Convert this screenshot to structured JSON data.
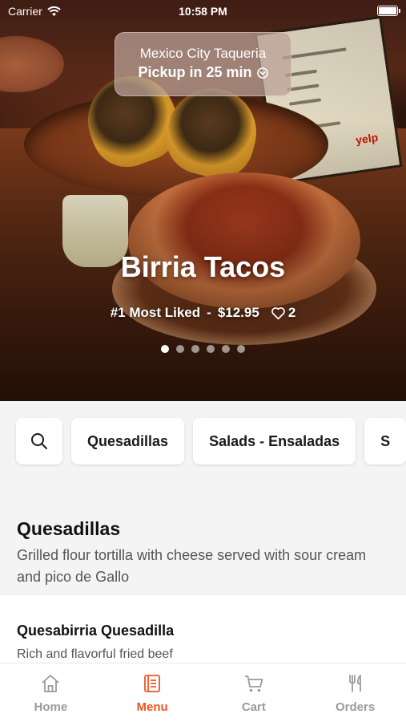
{
  "status_bar": {
    "carrier": "Carrier",
    "time": "10:58 PM"
  },
  "restaurant": {
    "name": "Mexico City Taqueria",
    "pickup": "Pickup in 25 min"
  },
  "featured": {
    "title": "Birria Tacos",
    "rank": "#1 Most Liked",
    "separator": "-",
    "price": "$12.95",
    "likes": "2"
  },
  "carousel": {
    "count": 6,
    "active_index": 0
  },
  "categories": [
    "Quesadillas",
    "Salads - Ensaladas",
    "S"
  ],
  "section": {
    "title": "Quesadillas",
    "description": "Grilled flour tortilla with cheese served with sour cream and pico de Gallo"
  },
  "item": {
    "title": "Quesabirria Quesadilla",
    "description": "Rich and flavorful fried beef"
  },
  "tabs": [
    {
      "label": "Home",
      "icon": "home-icon",
      "active": false
    },
    {
      "label": "Menu",
      "icon": "menu-book-icon",
      "active": true
    },
    {
      "label": "Cart",
      "icon": "cart-icon",
      "active": false
    },
    {
      "label": "Orders",
      "icon": "utensils-icon",
      "active": false
    }
  ],
  "colors": {
    "accent": "#f05423",
    "inactive": "#9a9a9a"
  }
}
